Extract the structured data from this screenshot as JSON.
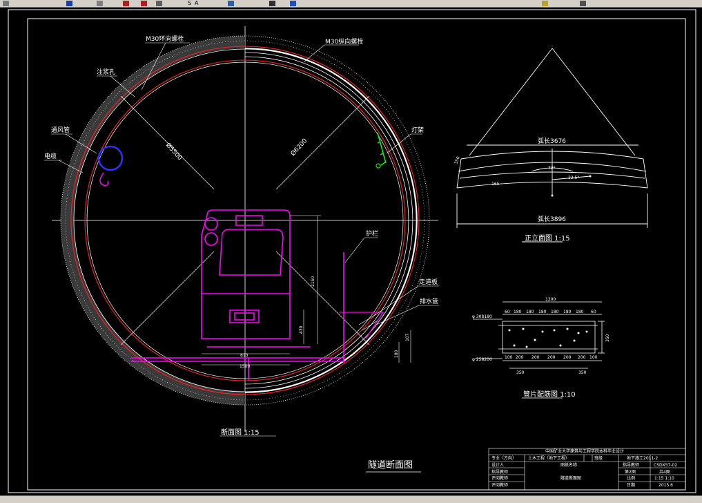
{
  "toolbar": {
    "buttons": [
      "arrow-icon",
      "cursor-icon",
      "undo-icon",
      "redo-icon",
      "text-tool-icon",
      "format-icon",
      "image-icon",
      "table-icon",
      "help-icon",
      "layer-icon",
      "properties-icon"
    ],
    "text_a": "A",
    "text_s": "S"
  },
  "section": {
    "labels": {
      "m30": "M30环向螺栓",
      "m30z": "M30纵向螺栓",
      "grout": "注浆孔",
      "vent": "通风管",
      "cable": "电缆",
      "light": "灯架",
      "rail": "护栏",
      "walk": "走道板",
      "drain": "排水管"
    },
    "dims": {
      "d5500": "Ø5500",
      "d6200": "Ø6200",
      "h2150": "2150",
      "h430": "430",
      "w813": "813",
      "w1500": "1500",
      "h180": "180",
      "h107": "107"
    },
    "title": "断面图   1:15"
  },
  "elevation": {
    "arc_top": "弧长3676",
    "arc_bottom": "弧长3896",
    "angle72": "72°",
    "angle22": "22.5°",
    "thk350": "350",
    "r165": "165",
    "title": "正立面图   1:15"
  },
  "rebar": {
    "top": "1200",
    "row1": [
      "60",
      "180",
      "180",
      "180",
      "180",
      "180",
      "180",
      "60"
    ],
    "row2": [
      "100",
      "200",
      "200",
      "200",
      "200",
      "200",
      "100"
    ],
    "bottom": [
      "350",
      "350"
    ],
    "side_left_top": "φ 308180",
    "side_left_bottom": "φ 258200",
    "side_right": "350",
    "title": "管片配筋图   1:10"
  },
  "main_title": "隧道断面图",
  "title_block": {
    "institution": "中国矿业大学建筑与工程学院本科毕业设计",
    "rows": [
      [
        "专业（方向）",
        "土木工程（地下工程）",
        "班级",
        "地下施工2011-2"
      ],
      [
        "设计人",
        "图纸名称",
        "指导教师",
        "CSDX57-02"
      ],
      [
        "指导教师",
        "",
        "第2图",
        "共4图"
      ],
      [
        "评阅教师",
        "",
        "比例",
        "1:15 1:10"
      ],
      [
        "评阅教师",
        "",
        "日期",
        "2015.6"
      ]
    ],
    "drawing_name": "隧道断面图"
  },
  "colors": {
    "frame": "#ffffff",
    "ring_red": "#ff2020",
    "ring_white": "#ffffff",
    "magenta": "#ff00ff",
    "blue": "#0000ff",
    "green": "#00ff00",
    "toolbar_bg": "#d4d0c8"
  }
}
